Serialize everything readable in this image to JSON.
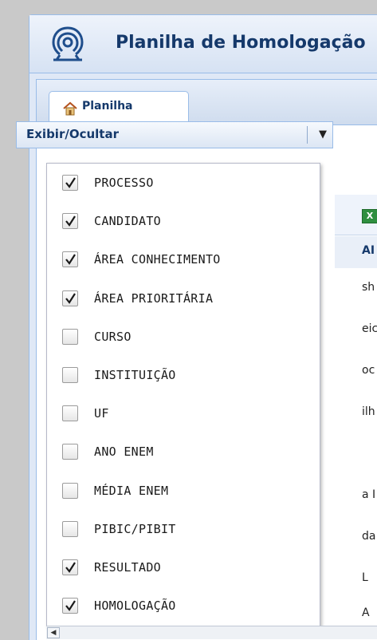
{
  "window": {
    "title": "Planilha de Homologação"
  },
  "tabs": [
    {
      "label": "Planilha"
    }
  ],
  "combo": {
    "label": "Exibir/Ocultar"
  },
  "columns_menu": {
    "options": [
      {
        "label": "PROCESSO",
        "checked": true
      },
      {
        "label": "CANDIDATO",
        "checked": true
      },
      {
        "label": "ÁREA CONHECIMENTO",
        "checked": true
      },
      {
        "label": "ÁREA PRIORITÁRIA",
        "checked": true
      },
      {
        "label": "CURSO",
        "checked": false
      },
      {
        "label": "INSTITUIÇÃO",
        "checked": false
      },
      {
        "label": "UF",
        "checked": false
      },
      {
        "label": "ANO ENEM",
        "checked": false
      },
      {
        "label": "MÉDIA ENEM",
        "checked": false
      },
      {
        "label": "PIBIC/PIBIT",
        "checked": false
      },
      {
        "label": "RESULTADO",
        "checked": true
      },
      {
        "label": "HOMOLOGAÇÃO",
        "checked": true
      }
    ]
  },
  "grid_fragments": {
    "header": "AI",
    "rows": [
      "sh",
      "eic",
      "oc",
      "ilh",
      "",
      "a I",
      "da",
      "L",
      "A"
    ]
  },
  "colors": {
    "title": "#15396b",
    "border": "#99bce8",
    "check": "#1a1a1a"
  }
}
